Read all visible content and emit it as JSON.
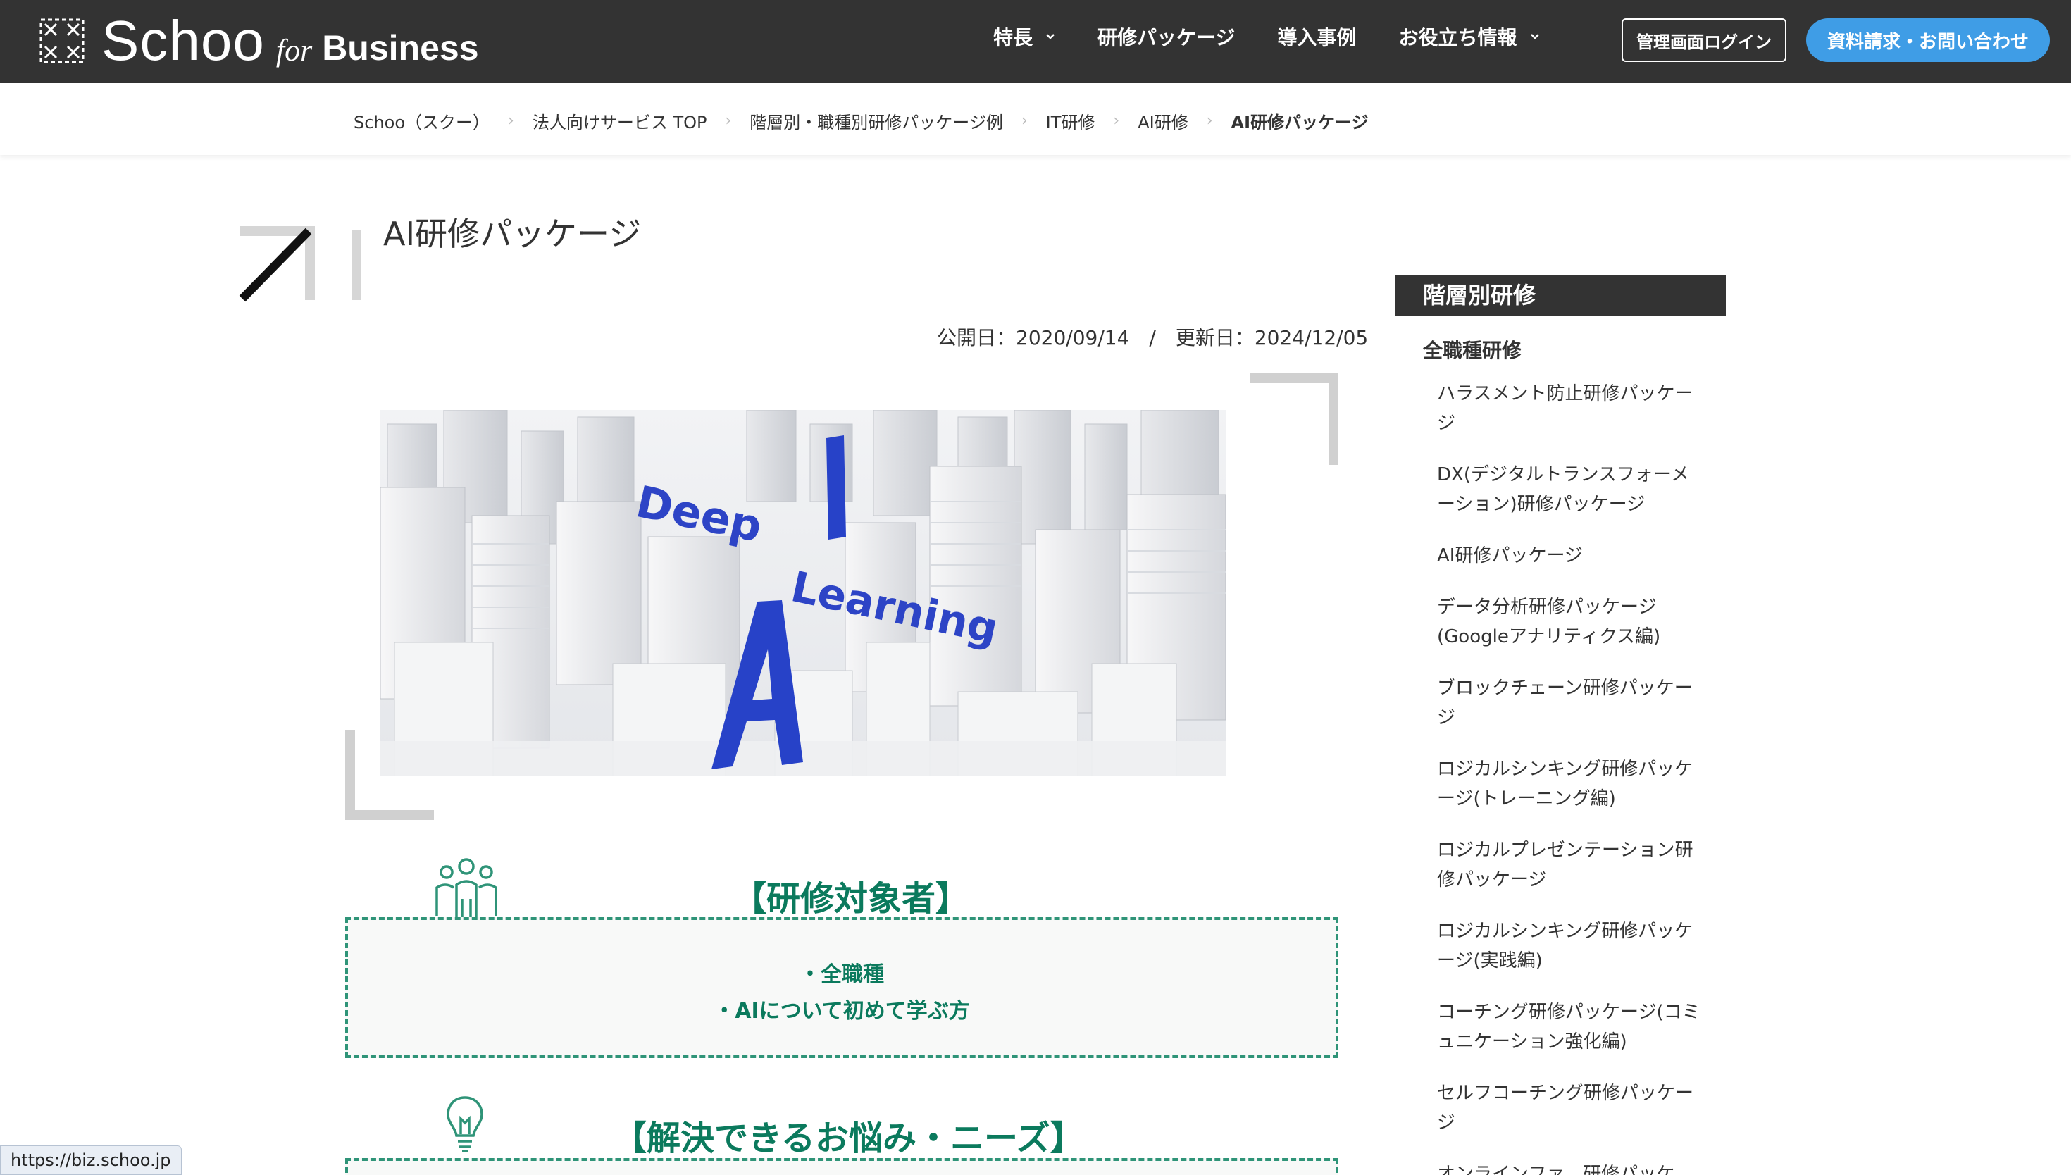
{
  "header": {
    "logo_word": "Schoo",
    "logo_for": "for",
    "logo_business": "Business",
    "nav": [
      {
        "label": "特長",
        "has_dropdown": true
      },
      {
        "label": "研修パッケージ",
        "has_dropdown": false
      },
      {
        "label": "導入事例",
        "has_dropdown": false
      },
      {
        "label": "お役立ち情報",
        "has_dropdown": true
      }
    ],
    "admin_login": "管理画面ログイン",
    "contact": "資料請求・お問い合わせ",
    "contact_color": "#3f9de6"
  },
  "breadcrumb": [
    "Schoo（スクー）",
    "法人向けサービス TOP",
    "階層別・職種別研修パッケージ例",
    "IT研修",
    "AI研修",
    "AI研修パッケージ"
  ],
  "page": {
    "title": "AI研修パッケージ",
    "dates": "公開日：2020/09/14　/　更新日：2024/12/05"
  },
  "hero": {
    "word1": "Deep",
    "word2": "Learning",
    "letter_a": "A",
    "letter_i": "I"
  },
  "sections": {
    "target": {
      "heading": "【研修対象者】",
      "items": [
        "・全職種",
        "・AIについて初めて学ぶ方"
      ],
      "icon": "people-icon"
    },
    "needs": {
      "heading": "【解決できるお悩み・ニーズ】",
      "icon": "lightbulb-icon"
    },
    "accent_color": "#0b7a5d"
  },
  "sidebar": {
    "heading": "階層別研修",
    "subheading": "全職種研修",
    "items": [
      "ハラスメント防止研修パッケージ",
      "DX(デジタルトランスフォーメーション)研修パッケージ",
      "AI研修パッケージ",
      "データ分析研修パッケージ(Googleアナリティクス編)",
      "ブロックチェーン研修パッケージ",
      "ロジカルシンキング研修パッケージ(トレーニング編)",
      "ロジカルプレゼンテーション研修パッケージ",
      "ロジカルシンキング研修パッケージ(実践編)",
      "コーチング研修パッケージ(コミュニケーション強化編)",
      "セルフコーチング研修パッケージ",
      "オンラインファ…研修パッケ…"
    ]
  },
  "status_url": "https://biz.schoo.jp"
}
